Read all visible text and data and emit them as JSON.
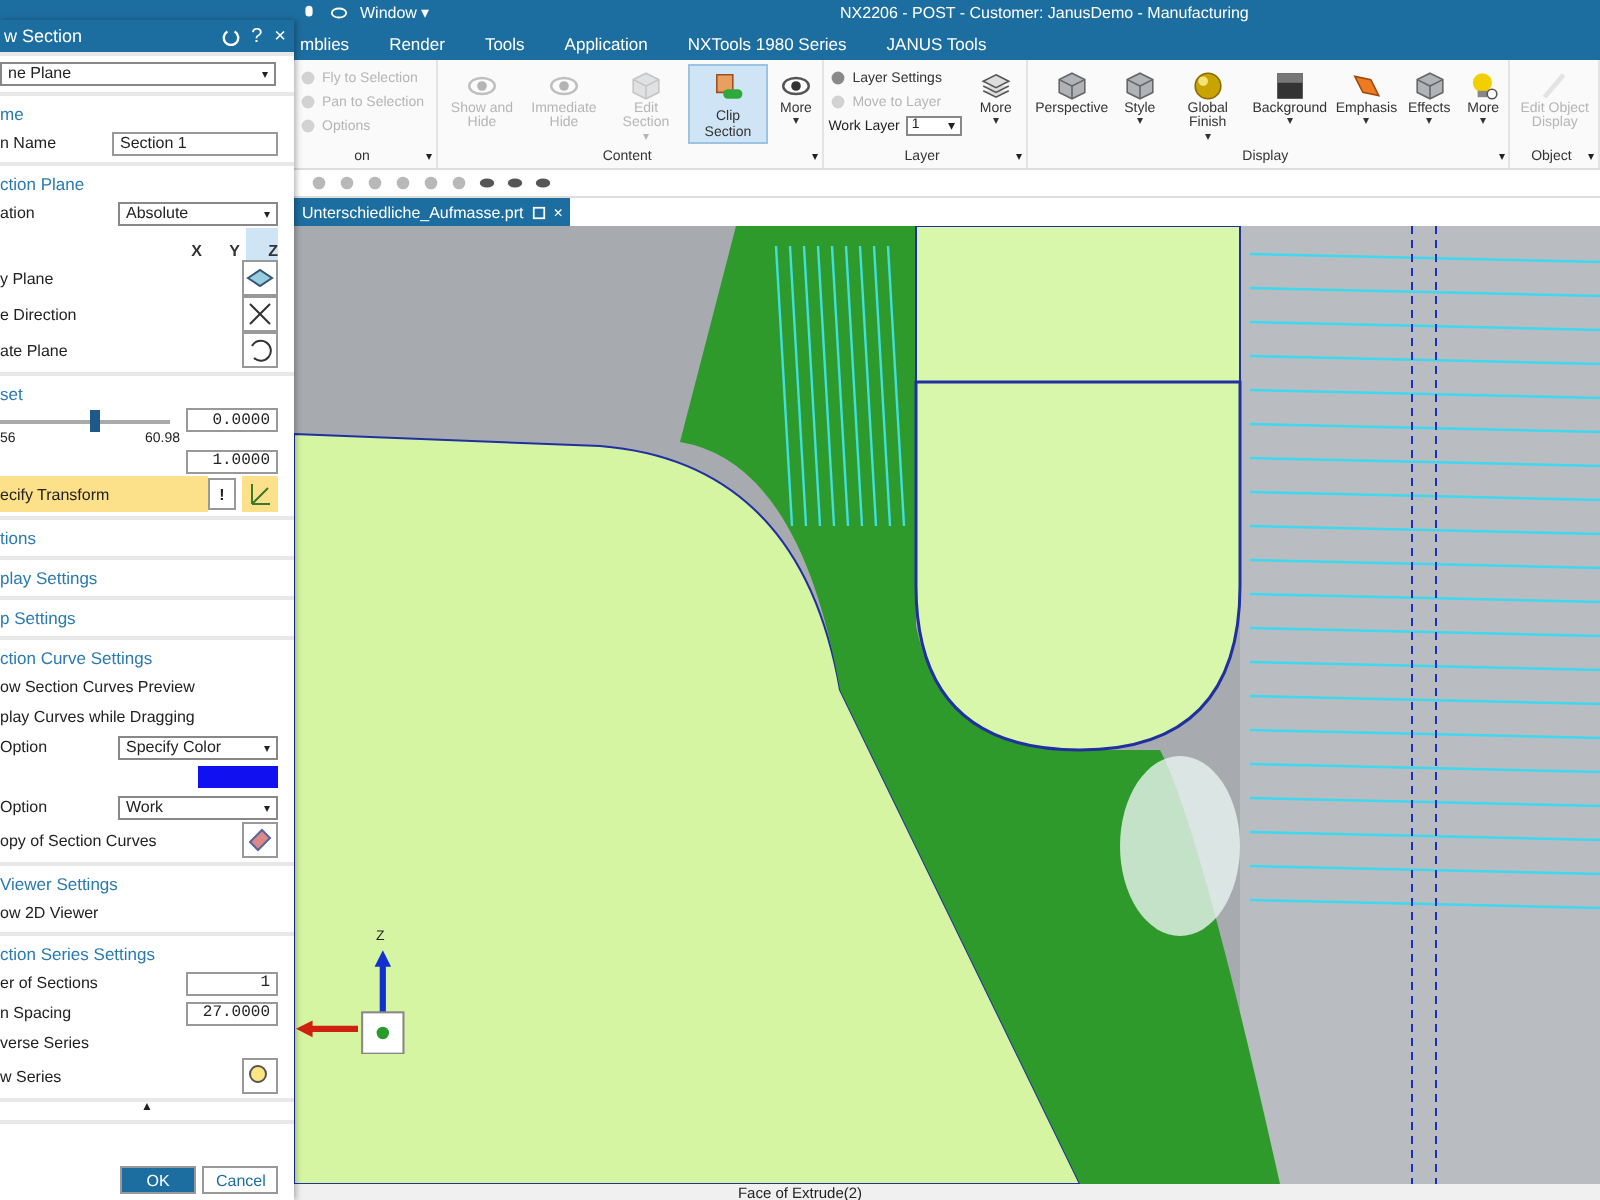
{
  "quick_access": {
    "menu": "Window",
    "caret": "▾"
  },
  "title_bar": {
    "title": "NX2206 - POST - Customer: JanusDemo - Manufacturing"
  },
  "menu_tabs": [
    {
      "label": "mblies",
      "selected": false
    },
    {
      "label": "Render",
      "selected": false
    },
    {
      "label": "Tools",
      "selected": false
    },
    {
      "label": "Application",
      "selected": false
    },
    {
      "label": "NXTools 1980 Series",
      "selected": false
    },
    {
      "label": "JANUS Tools",
      "selected": false
    }
  ],
  "ribbon": {
    "groups": [
      {
        "label": "on",
        "caret": "▾",
        "items": [
          {
            "kind": "small",
            "label": "Fly to Selection",
            "disabled": true
          },
          {
            "kind": "small",
            "label": "Pan to Selection",
            "disabled": true
          },
          {
            "kind": "small",
            "label": "Options",
            "disabled": true
          }
        ]
      },
      {
        "label": "Content",
        "caret": "▾",
        "items": [
          {
            "kind": "large",
            "label": "Show and Hide",
            "disabled": true,
            "selected": false
          },
          {
            "kind": "large",
            "label": "Immediate Hide",
            "disabled": true,
            "selected": false
          },
          {
            "kind": "large",
            "label": "Edit Section",
            "disabled": true,
            "selected": false,
            "caret": "▾"
          },
          {
            "kind": "large",
            "label": "Clip Section",
            "disabled": false,
            "selected": true
          },
          {
            "kind": "large",
            "label": "More",
            "disabled": false,
            "selected": false,
            "caret": "▾"
          }
        ]
      },
      {
        "label": "Layer",
        "caret": "▾",
        "items": [
          {
            "kind": "small",
            "label": "Layer Settings",
            "disabled": false
          },
          {
            "kind": "small",
            "label": "Move to Layer",
            "disabled": true
          },
          {
            "kind": "select",
            "label": "Work Layer",
            "value": "1",
            "caret": "▾"
          },
          {
            "kind": "large",
            "label": "More",
            "disabled": false,
            "selected": false,
            "caret": "▾"
          }
        ]
      },
      {
        "label": "Display",
        "caret": "▾",
        "items": [
          {
            "kind": "large",
            "label": "Perspective",
            "disabled": false,
            "selected": false
          },
          {
            "kind": "large",
            "label": "Style",
            "disabled": false,
            "selected": false,
            "caret": "▾"
          },
          {
            "kind": "large",
            "label": "Global Finish",
            "disabled": false,
            "selected": false,
            "caret": "▾"
          },
          {
            "kind": "large",
            "label": "Background",
            "disabled": false,
            "selected": false,
            "caret": "▾"
          },
          {
            "kind": "large",
            "label": "Emphasis",
            "disabled": false,
            "selected": false,
            "caret": "▾"
          },
          {
            "kind": "large",
            "label": "Effects",
            "disabled": false,
            "selected": false,
            "caret": "▾"
          },
          {
            "kind": "large",
            "label": "More",
            "disabled": false,
            "selected": false,
            "caret": "▾"
          }
        ]
      },
      {
        "label": "Object",
        "caret": "▾",
        "items": [
          {
            "kind": "large",
            "label": "Edit Object Display",
            "disabled": true,
            "selected": false
          }
        ]
      }
    ]
  },
  "document_tab": {
    "label": "Unterschiedliche_Aufmasse.prt",
    "close": "×"
  },
  "viewport": {
    "triad_axis": "Z"
  },
  "status_bar": {
    "text": "Face of Extrude(2)"
  },
  "dialog": {
    "title": "w Section",
    "help": "?",
    "close": "×",
    "panels": [
      {
        "rows": [
          {
            "kind": "select",
            "value": "ne Plane",
            "caret": "▾"
          }
        ]
      },
      {
        "rows": [
          {
            "kind": "header",
            "text": "me"
          },
          {
            "kind": "text_field",
            "label": "n Name",
            "value": "Section 1"
          }
        ]
      },
      {
        "rows": [
          {
            "kind": "header",
            "text": "ction Plane"
          },
          {
            "kind": "select",
            "label": "ation",
            "value": "Absolute",
            "caret": "▾"
          },
          {
            "kind": "axes",
            "buttons": [
              {
                "label": "X",
                "selected": false
              },
              {
                "label": "Y",
                "selected": false
              },
              {
                "label": "Z",
                "selected": true
              }
            ]
          },
          {
            "kind": "icon_row",
            "label": "y Plane"
          },
          {
            "kind": "icon_row",
            "label": "e Direction"
          },
          {
            "kind": "icon_row",
            "label": "ate Plane"
          }
        ]
      },
      {
        "rows": [
          {
            "kind": "header",
            "text": "set"
          },
          {
            "kind": "slider",
            "level": 0.56,
            "value": "0.0000",
            "min": "56",
            "max": "60.98"
          },
          {
            "kind": "number_field",
            "value": "1.0000"
          },
          {
            "kind": "highlight",
            "label": "ecify Transform",
            "warning": "!"
          }
        ]
      },
      {
        "rows": [
          {
            "kind": "header",
            "text": "tions"
          }
        ]
      },
      {
        "rows": [
          {
            "kind": "header",
            "text": "play Settings"
          }
        ]
      },
      {
        "rows": [
          {
            "kind": "header",
            "text": "p Settings"
          }
        ]
      },
      {
        "rows": [
          {
            "kind": "header",
            "text": "ction Curve Settings"
          },
          {
            "kind": "label",
            "text": "ow Section Curves Preview"
          },
          {
            "kind": "label",
            "text": "play Curves while Dragging"
          },
          {
            "kind": "select",
            "label": "Option",
            "value": "Specify Color",
            "caret": "▾"
          },
          {
            "kind": "color",
            "color": "#1010f0"
          },
          {
            "kind": "select",
            "label": "Option",
            "value": "Work",
            "caret": "▾"
          },
          {
            "kind": "icon_row",
            "label": "opy of Section Curves"
          }
        ]
      },
      {
        "rows": [
          {
            "kind": "header",
            "text": "Viewer Settings"
          },
          {
            "kind": "label",
            "text": "ow 2D Viewer"
          }
        ]
      },
      {
        "rows": [
          {
            "kind": "header",
            "text": "ction Series Settings"
          },
          {
            "kind": "number_field",
            "label": "er of Sections",
            "value": "1"
          },
          {
            "kind": "number_field",
            "label": "n Spacing",
            "value": "27.0000"
          },
          {
            "kind": "label",
            "text": "verse Series"
          },
          {
            "kind": "icon_row",
            "label": "w Series"
          }
        ]
      }
    ],
    "collapse": "▲",
    "buttons": [
      {
        "label": "OK",
        "primary": true
      },
      {
        "label": "Cancel",
        "primary": false
      }
    ]
  }
}
